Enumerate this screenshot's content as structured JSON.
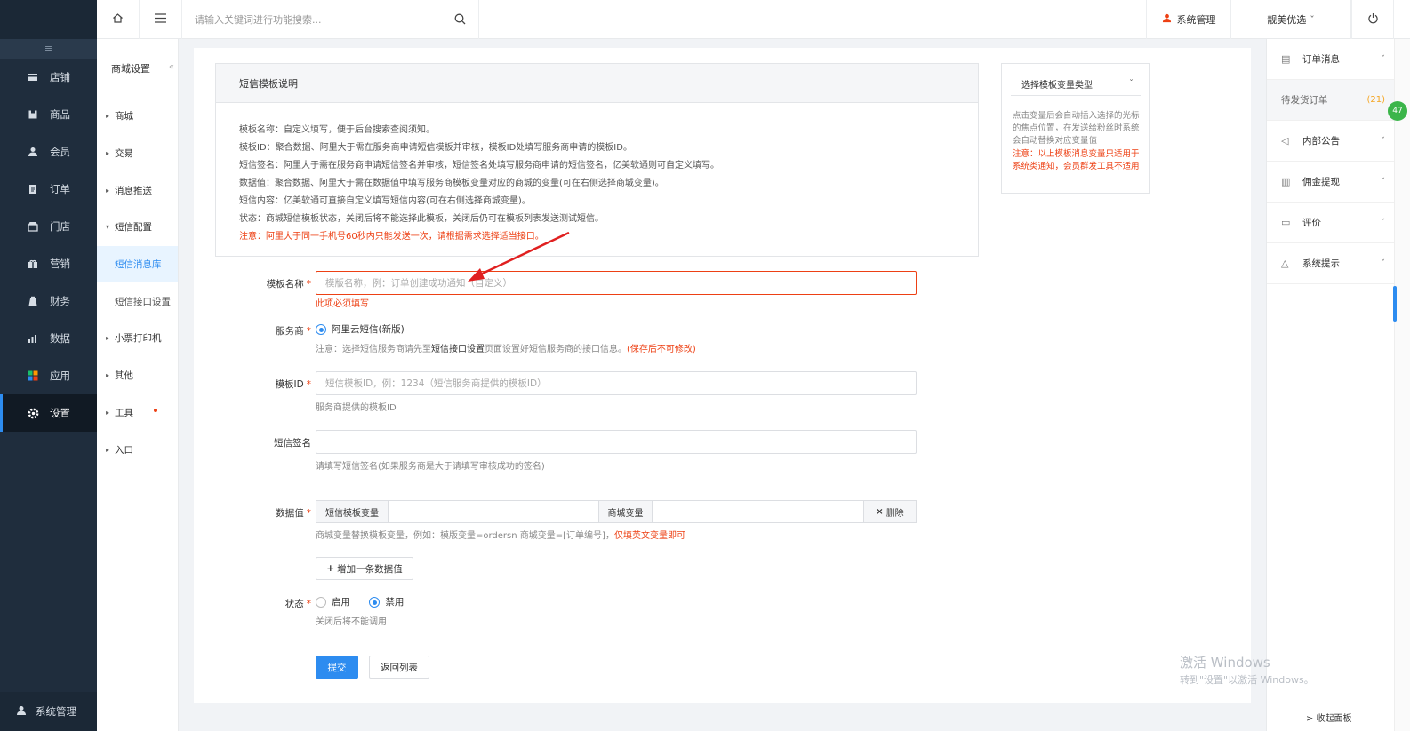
{
  "sidebar": {
    "collapse_icon": "≡",
    "items": [
      {
        "label": "店铺",
        "icon": "store-icon"
      },
      {
        "label": "商品",
        "icon": "goods-icon"
      },
      {
        "label": "会员",
        "icon": "user-icon"
      },
      {
        "label": "订单",
        "icon": "order-icon"
      },
      {
        "label": "门店",
        "icon": "shop-icon"
      },
      {
        "label": "营销",
        "icon": "gift-icon"
      },
      {
        "label": "财务",
        "icon": "money-icon"
      },
      {
        "label": "数据",
        "icon": "chart-icon"
      },
      {
        "label": "应用",
        "icon": "apps-icon"
      },
      {
        "label": "设置",
        "icon": "gear-icon"
      }
    ],
    "active_index": 9,
    "bottom_label": "系统管理"
  },
  "subnav": {
    "title": "商城设置",
    "items": [
      {
        "label": "商城",
        "type": "group"
      },
      {
        "label": "交易",
        "type": "group"
      },
      {
        "label": "消息推送",
        "type": "group"
      },
      {
        "label": "短信配置",
        "type": "open"
      },
      {
        "label": "短信消息库",
        "type": "child",
        "active": true
      },
      {
        "label": "短信接口设置",
        "type": "child"
      },
      {
        "label": "小票打印机",
        "type": "group"
      },
      {
        "label": "其他",
        "type": "group"
      },
      {
        "label": "工具",
        "type": "group",
        "dot": true
      },
      {
        "label": "入口",
        "type": "group"
      }
    ]
  },
  "topbar": {
    "search_placeholder": "请输入关键词进行功能搜索...",
    "admin_label": "系统管理",
    "store_label": "靓美优选",
    "store_caret": "ˇ"
  },
  "rightpanel": {
    "items": [
      {
        "label": "订单消息",
        "icon": "doc-icon",
        "chevron": "ˇ"
      },
      {
        "label": "待发货订单",
        "gray": true,
        "count": "(21)"
      },
      {
        "label": "内部公告",
        "icon": "speaker-icon",
        "chevron": "ˇ"
      },
      {
        "label": "佣金提现",
        "icon": "card-icon",
        "chevron": "ˇ"
      },
      {
        "label": "评价",
        "icon": "comment-icon",
        "chevron": "ˇ"
      },
      {
        "label": "系统提示",
        "icon": "bell-icon",
        "chevron": "ˇ"
      }
    ],
    "badge": "47",
    "collapse_label": "> 收起面板"
  },
  "template_info": {
    "title": "短信模板说明",
    "lines": [
      "模板名称：自定义填写，便于后台搜索查阅须知。",
      "模板ID：聚合数据、阿里大于需在服务商申请短信模板并审核，模板ID处填写服务商申请的模板ID。",
      "短信签名：阿里大于需在服务商申请短信签名并审核，短信签名处填写服务商申请的短信签名，亿美软通则可自定义填写。",
      "数据值：聚合数据、阿里大于需在数据值中填写服务商模板变量对应的商城的变量(可在右侧选择商城变量)。",
      "短信内容：亿美软通可直接自定义填写短信内容(可在右侧选择商城变量)。",
      "状态：商城短信模板状态，关闭后将不能选择此模板，关闭后仍可在模板列表发送测试短信。"
    ],
    "warning": "注意：阿里大于同一手机号60秒内只能发送一次，请根据需求选择适当接口。"
  },
  "variable_panel": {
    "select_label": "选择模板变量类型",
    "caret": "ˇ",
    "desc": "点击变量后会自动插入选择的光标的焦点位置，在发送给粉丝时系统会自动替换对应变量值",
    "note": "注意：以上模板消息变量只适用于系统类通知，会员群发工具不适用"
  },
  "form": {
    "name": {
      "label": "模板名称",
      "placeholder": "模版名称，例：订单创建成功通知（自定义）",
      "error": "此项必须填写"
    },
    "provider": {
      "label": "服务商",
      "option": "阿里云短信(新版)",
      "hint_prefix": "注意：选择短信服务商请先至",
      "hint_link": "短信接口设置",
      "hint_mid": "页面设置好短信服务商的接口信息。",
      "hint_red": "(保存后不可修改)"
    },
    "template_id": {
      "label": "模板ID",
      "placeholder": "短信模板ID，例：1234（短信服务商提供的模板ID）",
      "hint": "服务商提供的模板ID"
    },
    "signature": {
      "label": "短信签名",
      "value": "",
      "hint": "请填写短信签名(如果服务商是大于请填写审核成功的签名)"
    },
    "data_value": {
      "label": "数据值",
      "var_label": "短信模板变量",
      "shop_var_label": "商城变量",
      "delete_label": "删除",
      "delete_icon": "×",
      "hint": "商城变量替换模板变量，例如：模版变量=ordersn 商城变量=[订单编号]，",
      "hint_red": "仅填英文变量即可"
    },
    "add_button": "增加一条数据值",
    "add_icon": "+",
    "status": {
      "label": "状态",
      "enable": "启用",
      "disable": "禁用",
      "hint": "关闭后将不能调用"
    },
    "submit": "提交",
    "back": "返回列表"
  },
  "watermark": {
    "line1": "激活 Windows",
    "line2": "转到\"设置\"以激活 Windows。"
  },
  "colors": {
    "accent": "#2d8cf0",
    "danger": "#ed4014",
    "sidebar": "#1f2d3d"
  }
}
